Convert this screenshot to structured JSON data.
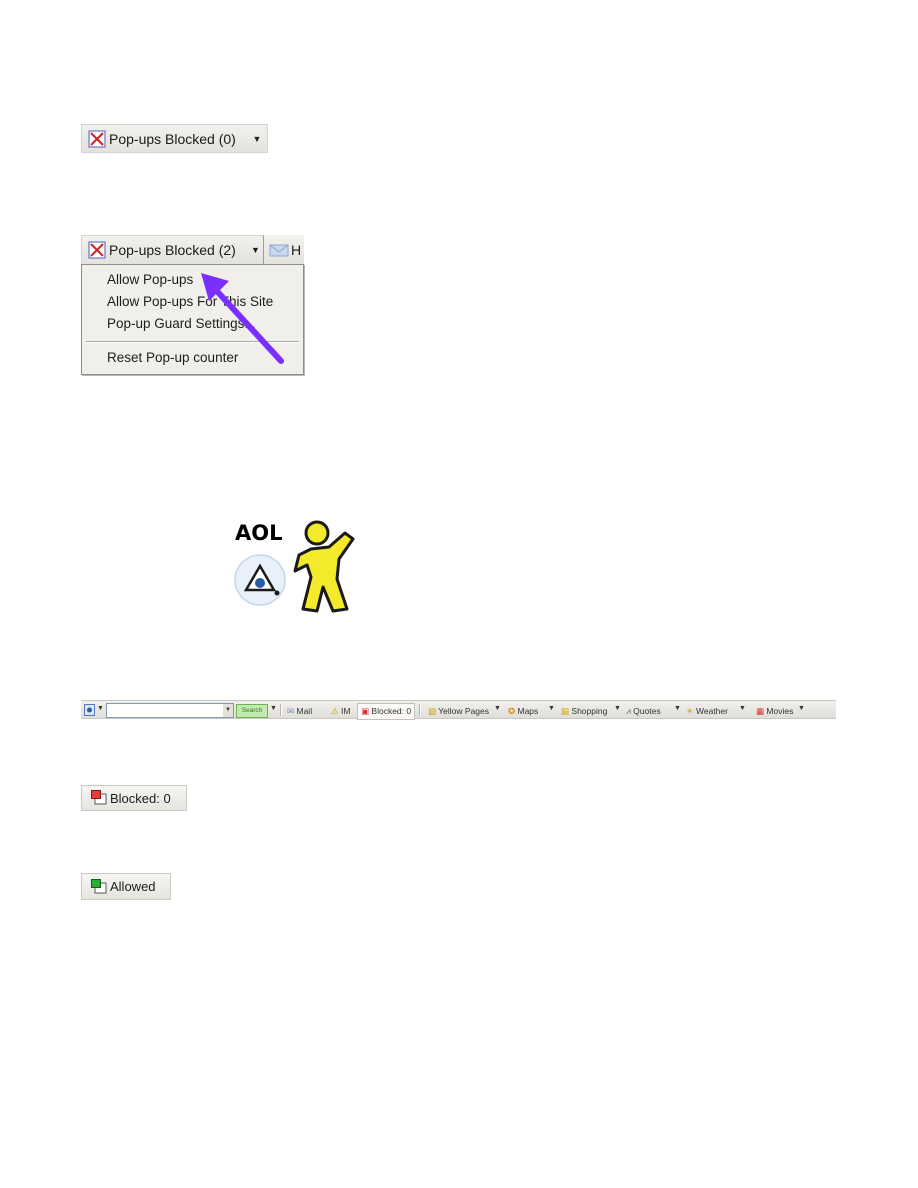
{
  "popup_bar_collapsed": {
    "label": "Pop-ups Blocked (0)"
  },
  "popup_bar_expanded": {
    "label": "Pop-ups Blocked (2)",
    "next_button_letter": "H",
    "menu": {
      "items": [
        "Allow Pop-ups",
        "Allow Pop-ups For This Site",
        "Pop-up Guard Settings...",
        "Reset Pop-up counter"
      ]
    },
    "arrow_color": "#7b2fff"
  },
  "aol_logo": {
    "text": "AOL",
    "figure_color": "#f2ea2a"
  },
  "aol_toolbar": {
    "search_button": "Search",
    "items": [
      "Mail",
      "IM",
      "Blocked: 0",
      "Yellow Pages",
      "Maps",
      "Shopping",
      "Quotes",
      "Weather",
      "Movies"
    ]
  },
  "blocked_status": {
    "label": "Blocked: 0",
    "icon_color": "#e53b3b"
  },
  "allowed_status": {
    "label": "Allowed",
    "icon_color": "#28b033"
  }
}
